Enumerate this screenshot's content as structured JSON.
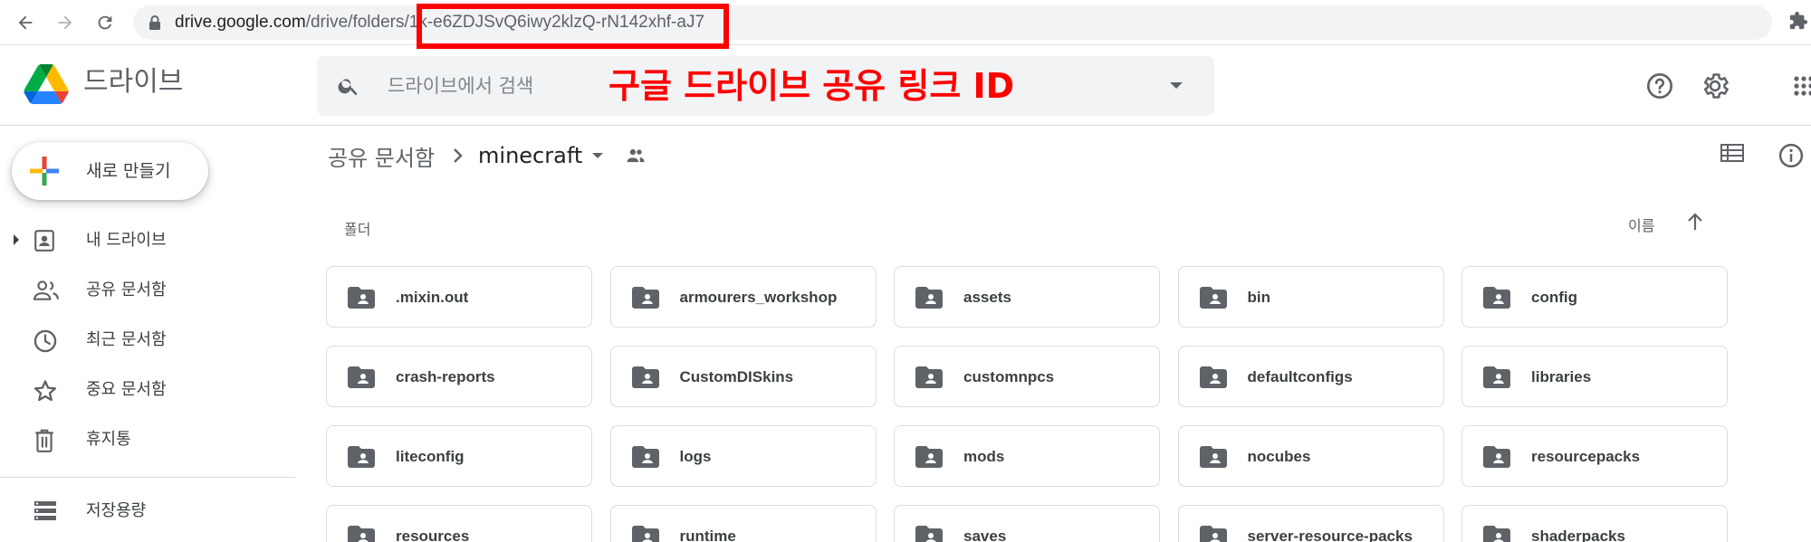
{
  "browser": {
    "url_host": "drive.google.com",
    "url_path": "/drive/folders/",
    "url_folder_id": "1k-e6ZDJSvQ6iwy2klzQ-rN142xhf-aJ7"
  },
  "header": {
    "app_name": "드라이브",
    "search_placeholder": "드라이브에서 검색",
    "annotation": "구글 드라이브 공유 링크 ID"
  },
  "sidebar": {
    "new_label": "새로 만들기",
    "items": [
      {
        "label": "내 드라이브",
        "icon": "my-drive-icon"
      },
      {
        "label": "공유 문서함",
        "icon": "shared-people-icon"
      },
      {
        "label": "최근 문서함",
        "icon": "clock-icon"
      },
      {
        "label": "중요 문서함",
        "icon": "star-icon"
      },
      {
        "label": "휴지통",
        "icon": "trash-icon"
      },
      {
        "label": "저장용량",
        "icon": "storage-icon"
      }
    ]
  },
  "breadcrumb": {
    "root": "공유 문서함",
    "current": "minecraft"
  },
  "section": {
    "label": "폴더",
    "sort_label": "이름"
  },
  "folders": [
    ".mixin.out",
    "armourers_workshop",
    "assets",
    "bin",
    "config",
    "crash-reports",
    "CustomDISkins",
    "customnpcs",
    "defaultconfigs",
    "libraries",
    "liteconfig",
    "logs",
    "mods",
    "nocubes",
    "resourcepacks",
    "resources",
    "runtime",
    "saves",
    "server-resource-packs",
    "shaderpacks"
  ],
  "colors": {
    "annotation": "#ff0000",
    "highlight_box": "#ff0000",
    "icon_gray": "#5f6368"
  }
}
